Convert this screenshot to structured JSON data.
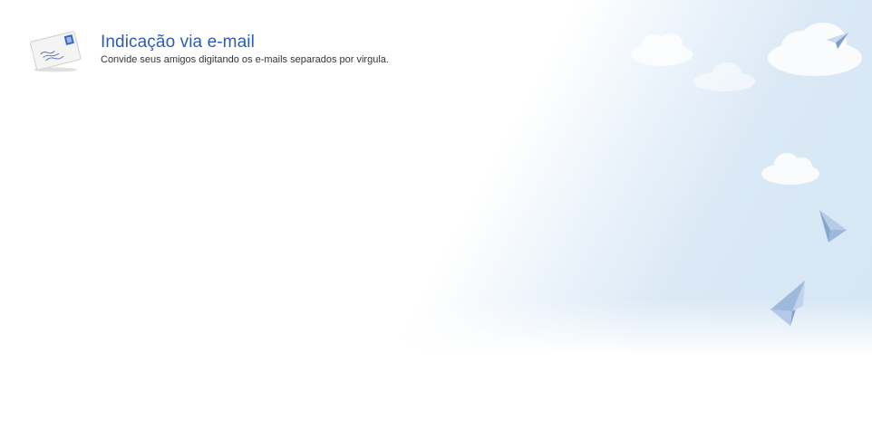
{
  "header": {
    "title": "Indicação via e-mail",
    "subtitle": "Convide seus amigos digitando os e-mails separados por virgula."
  },
  "icons": {
    "envelope": "envelope-icon",
    "plane": "paper-plane-icon",
    "cloud": "cloud-icon"
  },
  "colors": {
    "title": "#2f5bb5",
    "sky": "#d4e6f4",
    "plane": "#8fb2d8"
  }
}
